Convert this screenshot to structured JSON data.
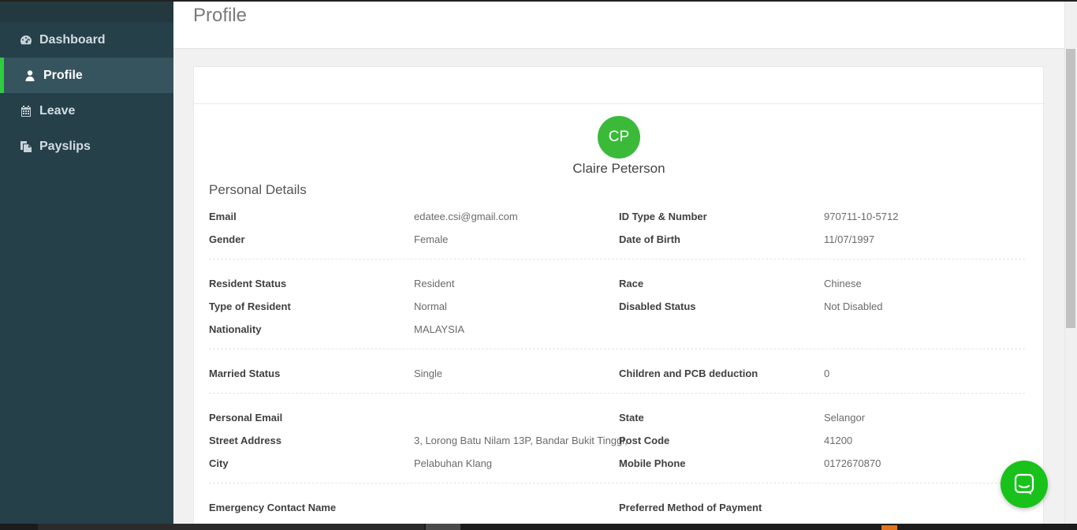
{
  "sidebar": {
    "items": [
      {
        "label": "Dashboard",
        "icon": "dashboard-icon"
      },
      {
        "label": "Profile",
        "icon": "user-icon",
        "active": true
      },
      {
        "label": "Leave",
        "icon": "calendar-icon"
      },
      {
        "label": "Payslips",
        "icon": "copy-icon"
      }
    ]
  },
  "header": {
    "title": "Profile"
  },
  "profile": {
    "initials": "CP",
    "name": "Claire Peterson",
    "section_title": "Personal Details",
    "groups": [
      [
        {
          "l1": "Email",
          "v1": "edatee.csi@gmail.com",
          "l2": "ID Type & Number",
          "v2": "970711-10-5712"
        },
        {
          "l1": "Gender",
          "v1": "Female",
          "l2": "Date of Birth",
          "v2": "11/07/1997"
        }
      ],
      [
        {
          "l1": "Resident Status",
          "v1": "Resident",
          "l2": "Race",
          "v2": "Chinese"
        },
        {
          "l1": "Type of Resident",
          "v1": "Normal",
          "l2": "Disabled Status",
          "v2": "Not Disabled"
        },
        {
          "l1": "Nationality",
          "v1": "MALAYSIA",
          "l2": "",
          "v2": ""
        }
      ],
      [
        {
          "l1": "Married Status",
          "v1": "Single",
          "l2": "Children and PCB deduction",
          "v2": "0"
        }
      ],
      [
        {
          "l1": "Personal Email",
          "v1": "",
          "l2": "State",
          "v2": "Selangor"
        },
        {
          "l1": "Street Address",
          "v1": "3, Lorong Batu Nilam 13P, Bandar Bukit Tinggi,",
          "l2": "Post Code",
          "v2": "41200"
        },
        {
          "l1": "City",
          "v1": "Pelabuhan Klang",
          "l2": "Mobile Phone",
          "v2": "0172670870"
        }
      ],
      [
        {
          "l1": "Emergency Contact Name",
          "v1": "",
          "l2": "Preferred Method of Payment",
          "v2": ""
        }
      ]
    ]
  },
  "colors": {
    "sidebar_bg": "#26404a",
    "active_item_bg": "#36545e",
    "accent": "#2ecc40",
    "avatar_bg": "#3bba3a",
    "chat_button": "#18c21a"
  },
  "chat": {
    "icon": "chat-bubble-icon"
  }
}
